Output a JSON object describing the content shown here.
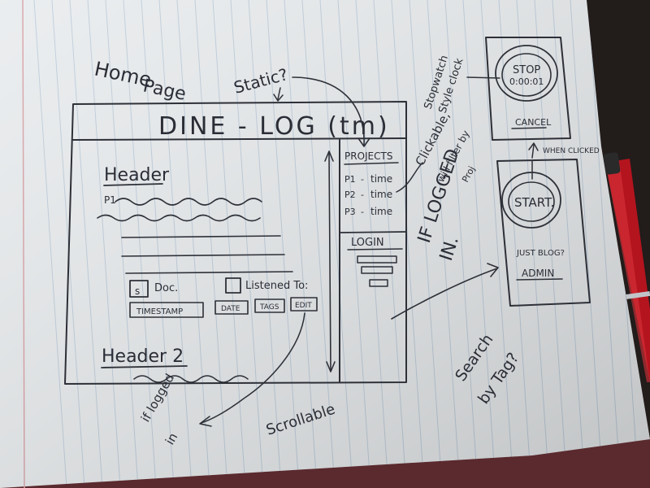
{
  "notes": {
    "home_page": [
      "Home",
      "Page"
    ],
    "static_question": "Static?",
    "stopwatch_note": [
      "Stopwatch",
      "Style clock"
    ],
    "clickable_note": [
      "Clickable,",
      "will filter by",
      "Proj"
    ],
    "if_logged_in": [
      "IF LOGGED",
      "IN."
    ],
    "if_logged_in_small": [
      "if logged",
      "in"
    ],
    "scrollable": "Scrollable",
    "search_by_tag": [
      "Search",
      "by Tag?"
    ],
    "when_clicked": "WHEN CLICKED"
  },
  "main_page": {
    "title": "DINE - LOG (tm)",
    "header1": "Header",
    "header1_sub": "P1",
    "doc_checkbox_label": "Doc.",
    "doc_checkbox_mark": "s",
    "listened_checkbox_label": "Listened To:",
    "buttons": [
      "TIMESTAMP",
      "DATE",
      "TAGS",
      "EDIT"
    ],
    "header2": "Header 2",
    "sidebar": {
      "projects_heading": "PROJECTS",
      "projects": [
        {
          "name": "P1",
          "sep": "-",
          "value": "time"
        },
        {
          "name": "P2",
          "sep": "-",
          "value": "time"
        },
        {
          "name": "P3",
          "sep": "-",
          "value": "time"
        }
      ],
      "login_heading": "LOGIN"
    }
  },
  "stopwatch_screen": {
    "stop_label": "STOP",
    "time": "0:00:01",
    "cancel_label": "CANCEL"
  },
  "start_screen": {
    "start_label": "START.",
    "just_blog": "JUST BLOG?",
    "admin_label": "ADMIN"
  },
  "colors": {
    "paper": "#eceef0",
    "ink": "#2e3038",
    "rule_lines": "#9db6cf",
    "margin_line": "#d9a0a6",
    "pen_red": "#b4141e"
  }
}
